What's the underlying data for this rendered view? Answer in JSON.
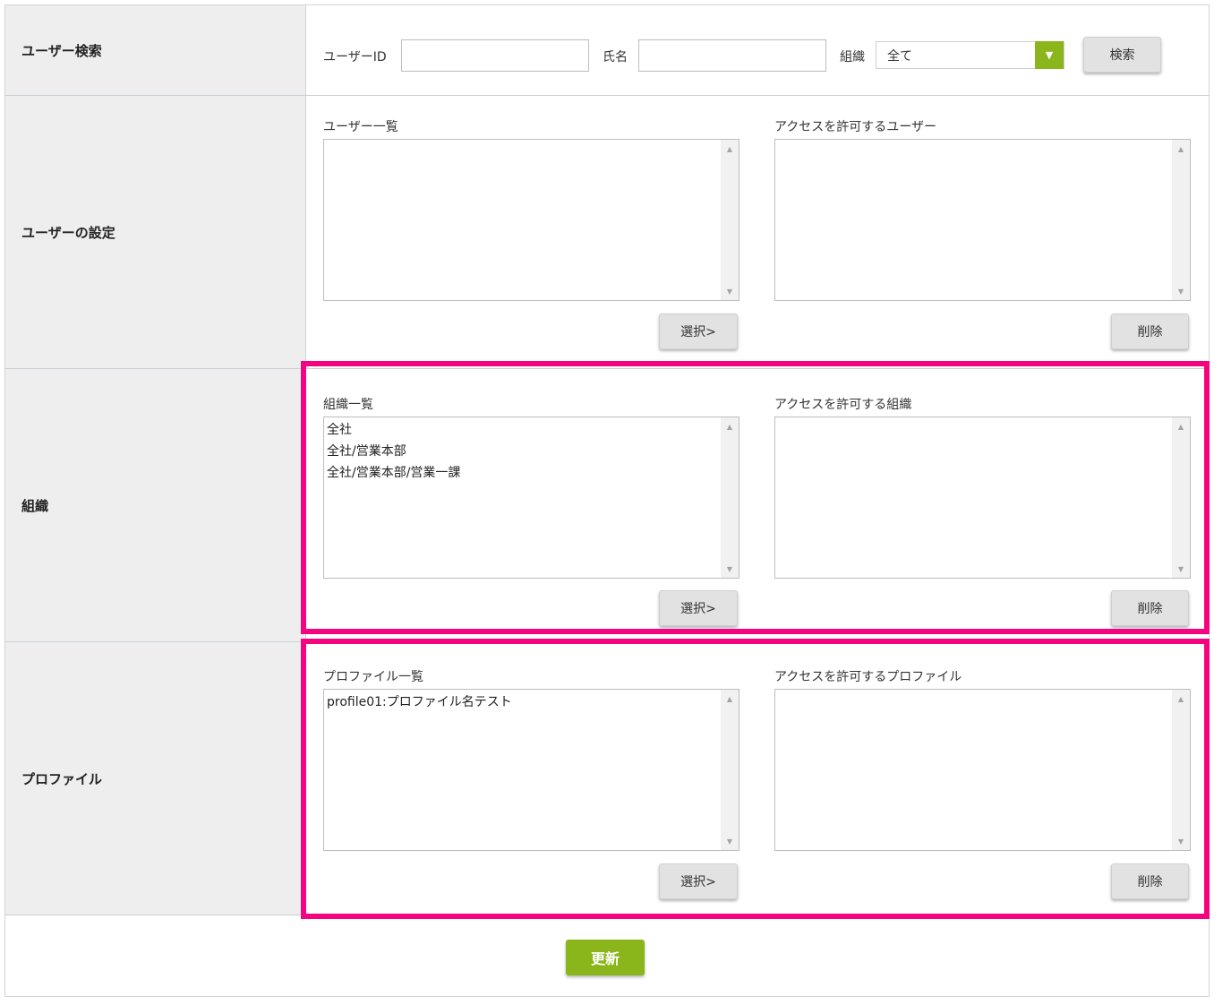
{
  "search": {
    "row_label": "ユーザー検索",
    "user_id_label": "ユーザーID",
    "user_id_value": "",
    "name_label": "氏名",
    "name_value": "",
    "org_label": "組織",
    "org_selected": "全て",
    "search_button": "検索"
  },
  "users": {
    "row_label": "ユーザーの設定",
    "available_label": "ユーザー一覧",
    "available_items": [],
    "allowed_label": "アクセスを許可するユーザー",
    "allowed_items": [],
    "select_button": "選択>",
    "delete_button": "削除"
  },
  "orgs": {
    "row_label": "組織",
    "available_label": "組織一覧",
    "available_items": [
      "全社",
      "全社/営業本部",
      "全社/営業本部/営業一課"
    ],
    "allowed_label": "アクセスを許可する組織",
    "allowed_items": [],
    "select_button": "選択>",
    "delete_button": "削除"
  },
  "profiles": {
    "row_label": "プロファイル",
    "available_label": "プロファイル一覧",
    "available_items": [
      "profile01:プロファイル名テスト"
    ],
    "allowed_label": "アクセスを許可するプロファイル",
    "allowed_items": [],
    "select_button": "選択>",
    "delete_button": "削除"
  },
  "update_button": "更新",
  "colors": {
    "accent_green": "#8ab61c",
    "highlight_pink": "#f5047f",
    "label_bg": "#eeeeee"
  },
  "icons": {
    "dropdown": "triangle-down",
    "scroll_up": "triangle-up",
    "scroll_down": "triangle-down"
  }
}
